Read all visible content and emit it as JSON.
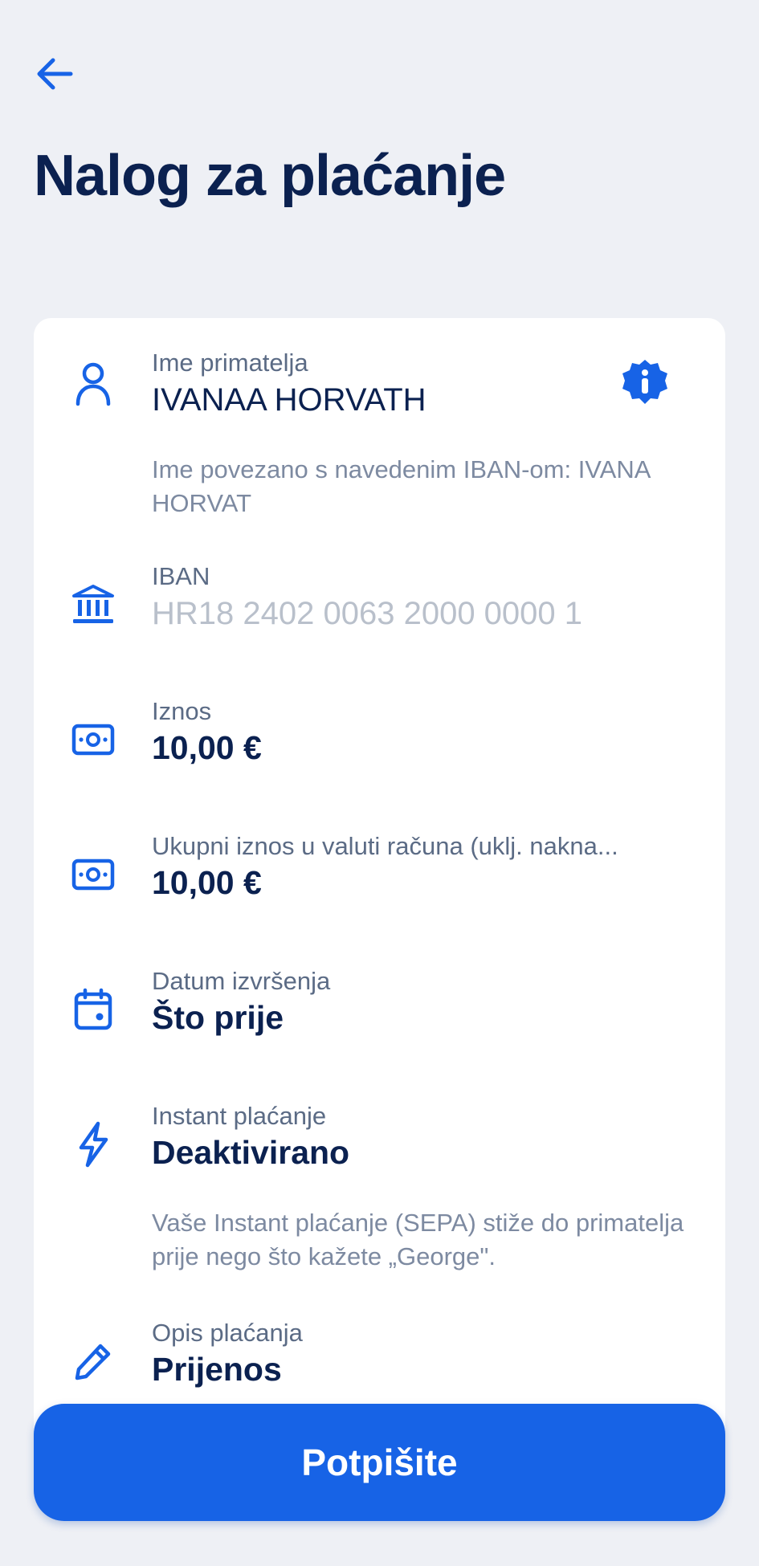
{
  "header": {
    "back_icon": "arrow-left-icon",
    "title": "Nalog za plaćanje"
  },
  "form": {
    "recipient": {
      "icon": "person-icon",
      "label": "Ime primatelja",
      "value": "IVANAA HORVATH",
      "info_icon": "info-badge-icon",
      "note": "Ime povezano s navedenim IBAN-om:  IVANA HORVAT"
    },
    "iban": {
      "icon": "bank-icon",
      "label": "IBAN",
      "value": "HR18 2402 0063 2000 0000 1"
    },
    "amount": {
      "icon": "banknote-icon",
      "label": "Iznos",
      "value": "10,00 €"
    },
    "total_amount": {
      "icon": "banknote-icon",
      "label": "Ukupni iznos u valuti računa (uklj. nakna...",
      "value": "10,00 €"
    },
    "execution_date": {
      "icon": "calendar-icon",
      "label": "Datum izvršenja",
      "value": "Što prije"
    },
    "instant_payment": {
      "icon": "lightning-icon",
      "label": "Instant plaćanje",
      "value": "Deaktivirano",
      "note": "Vaše Instant plaćanje (SEPA) stiže do primatelja prije nego što kažete „George\"."
    },
    "description": {
      "icon": "pencil-icon",
      "label": "Opis plaćanja",
      "value": "Prijenos"
    }
  },
  "actions": {
    "sign_label": "Potpišite"
  },
  "colors": {
    "background": "#eef0f5",
    "card": "#ffffff",
    "title": "#0b2150",
    "accent": "#1763e6",
    "label": "#5b6b85",
    "muted_value": "#b9c0cb"
  }
}
